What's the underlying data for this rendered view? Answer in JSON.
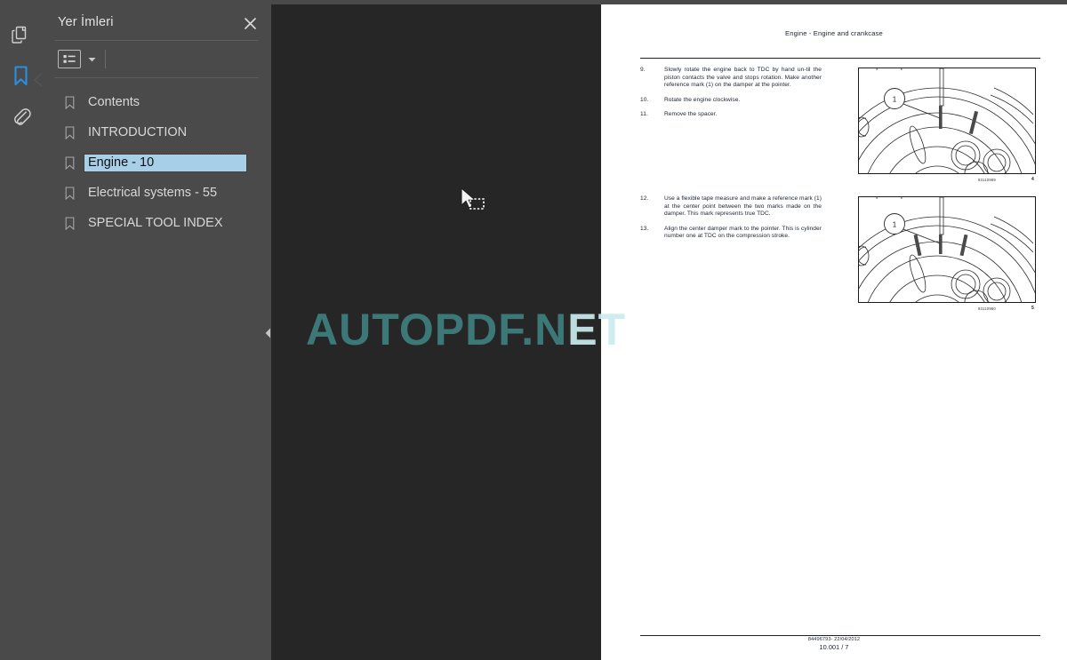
{
  "app": {
    "background_color": "#262626",
    "panel_color": "#4a4a4a",
    "accent_color": "#2a8fe0",
    "selection_color": "#a8cfe8"
  },
  "rail": {
    "items": [
      {
        "icon": "pages-thumbnails-icon",
        "name": "rail-item-pages",
        "active": false
      },
      {
        "icon": "bookmark-icon",
        "name": "rail-item-bookmarks",
        "active": true
      },
      {
        "icon": "attachment-paperclip-icon",
        "name": "rail-item-attachments",
        "active": false
      }
    ]
  },
  "panel": {
    "title": "Yer İmleri",
    "close_label": "✕",
    "toolbar": {
      "options_icon": "list-options-icon",
      "caret_icon": "chevron-down-icon"
    },
    "bookmarks": [
      {
        "label": "Contents",
        "selected": false
      },
      {
        "label": "INTRODUCTION",
        "selected": false
      },
      {
        "label": "Engine - 10",
        "selected": true
      },
      {
        "label": "Electrical systems - 55",
        "selected": false
      },
      {
        "label": "SPECIAL TOOL INDEX",
        "selected": false
      }
    ]
  },
  "collapse_handle": {
    "icon": "chevron-left-icon",
    "tooltip": "Collapse panel"
  },
  "watermark": {
    "text_dark": "AUTOPDF.N",
    "text_light": "ET",
    "color_dark": "#3f7f7f",
    "color_light": "#c9ecee"
  },
  "cursor": {
    "type": "snapshot-selection-cursor"
  },
  "document": {
    "header": "Engine - Engine and crankcase",
    "footer_line1": "84496793- 22/04/2012",
    "footer_line2": "10.001 / 7",
    "sections": [
      {
        "steps": [
          {
            "num": "9.",
            "text": "Slowly rotate the engine back to TDC by hand un-til the piston contacts the valve and stops rotation. Make another reference mark (1) on the damper at the pointer."
          },
          {
            "num": "10.",
            "text": "Rotate the engine clockwise."
          },
          {
            "num": "11.",
            "text": "Remove the spacer."
          }
        ],
        "figure": {
          "callout": "1",
          "caption_code": "93110969",
          "caption_num": "4"
        }
      },
      {
        "steps": [
          {
            "num": "12.",
            "text": "Use a flexible tape measure and make a reference mark (1) at the center point between the two marks made on the damper.  This mark represents true TDC."
          },
          {
            "num": "13.",
            "text": "Align the center damper mark to the pointer.  This is cylinder number one at TDC on the compression stroke."
          }
        ],
        "figure": {
          "callout": "1",
          "caption_code": "93110960",
          "caption_num": "5"
        }
      }
    ]
  }
}
